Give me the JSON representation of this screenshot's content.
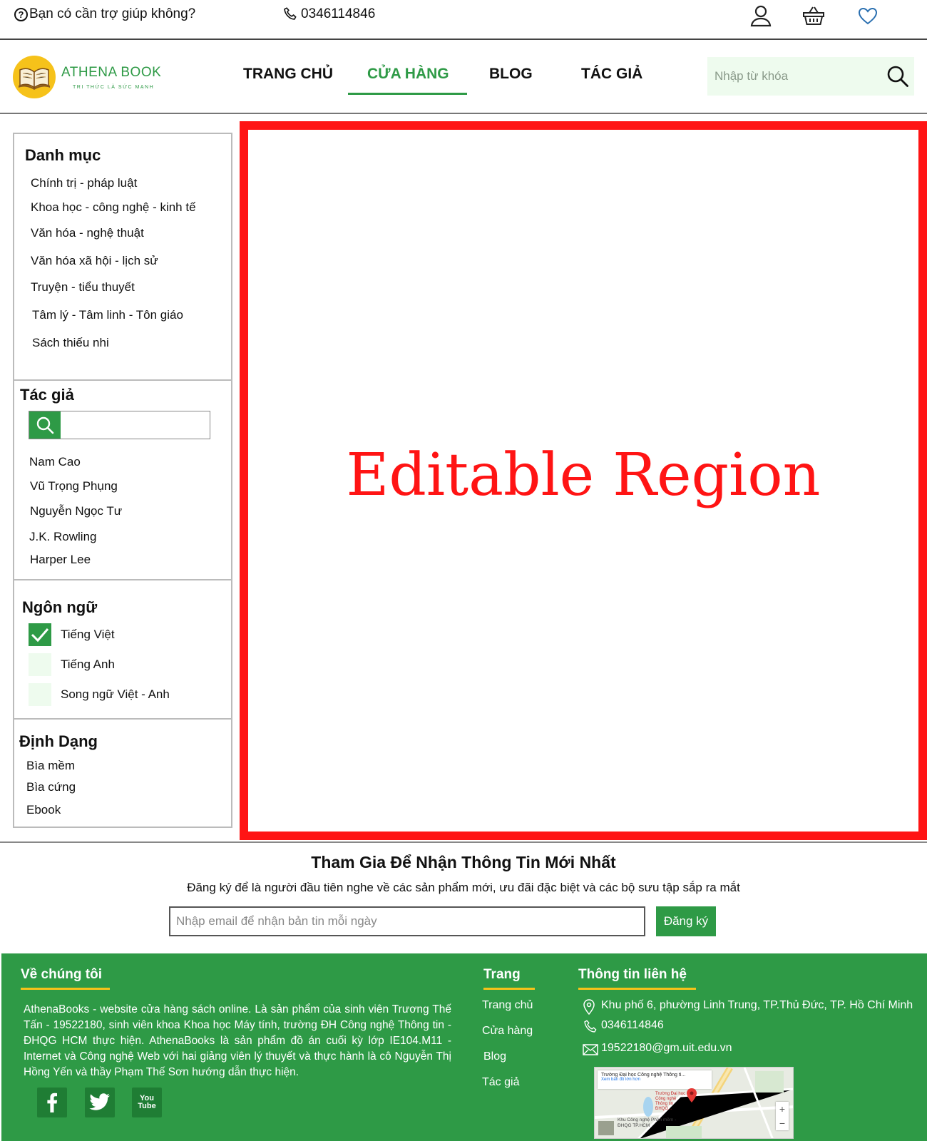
{
  "topbar": {
    "help_text": "Bạn có cần trợ giúp không?",
    "help_icon": "?",
    "phone": "0346114846",
    "icons": [
      "user-icon",
      "basket-icon",
      "heart-icon"
    ]
  },
  "header": {
    "logo_name": "ATHENA BOOK",
    "logo_tagline": "TRI THỨC LÀ SỨC MẠNH",
    "nav": [
      "TRANG CHỦ",
      "CỬA HÀNG",
      "BLOG",
      "TÁC GIẢ"
    ],
    "active_nav": "CỬA HÀNG",
    "search_placeholder": "Nhập từ khóa"
  },
  "sidebar": {
    "categories": {
      "title": "Danh mục",
      "items": [
        "Chính trị - pháp luật",
        "Khoa học - công nghệ - kinh tế",
        "Văn hóa - nghệ thuật",
        "Văn hóa  xã hội - lịch sử",
        "Truyện - tiểu thuyết",
        "Tâm lý - Tâm linh - Tôn giáo",
        "Sách thiếu nhi"
      ]
    },
    "authors": {
      "title": "Tác giả",
      "search_value": "",
      "items": [
        "Nam Cao",
        "Vũ Trọng Phụng",
        "Nguyễn Ngọc Tư",
        "J.K. Rowling",
        "Harper Lee"
      ]
    },
    "languages": {
      "title": "Ngôn ngữ",
      "items": [
        {
          "label": "Tiếng Việt",
          "checked": true
        },
        {
          "label": "Tiếng Anh",
          "checked": false
        },
        {
          "label": "Song ngữ Việt - Anh",
          "checked": false
        }
      ]
    },
    "formats": {
      "title": "Định Dạng",
      "items": [
        "Bìa mềm",
        "Bìa cứng",
        "Ebook"
      ]
    }
  },
  "editable_region": {
    "label": "Editable Region",
    "color": "#ff1414"
  },
  "newsletter": {
    "title": "Tham Gia Để Nhận Thông Tin Mới Nhất",
    "subtitle": "Đăng ký để là người đầu tiên nghe về các sản phẩm mới, ưu đãi đặc biệt và các bộ sưu tập sắp ra mắt",
    "placeholder": "Nhập email để nhận bản tin mỗi ngày",
    "button": "Đăng ký"
  },
  "footer": {
    "about_title": "Về chúng tôi",
    "about_text": "AthenaBooks - website cửa hàng sách online. Là sản phẩm của sinh viên Trương Thế Tấn - 19522180, sinh viên khoa Khoa học Máy tính, trường ĐH Công nghệ Thông tin - ĐHQG HCM thực hiện. AthenaBooks là sản phẩm đồ án cuối kỳ lớp IE104.M11 - Internet và Công nghệ Web với hai giảng viên lý thuyết và thực hành là cô Nguyễn Thị Hồng Yến và thầy Phạm Thế Sơn hướng dẫn thực hiện.",
    "social": [
      "facebook-icon",
      "twitter-icon",
      "youtube-icon"
    ],
    "youtube_text": "You Tube",
    "pages_title": "Trang",
    "pages": [
      "Trang chủ",
      "Cửa hàng",
      "Blog",
      "Tác giả"
    ],
    "contact_title": "Thông tin liên hệ",
    "address": "Khu phố 6, phường Linh Trung, TP.Thủ Đức, TP. Hồ Chí Minh",
    "phone": "0346114846",
    "email": "19522180@gm.uit.edu.vn",
    "map_title": "Trường Đại học Công nghệ Thông ti...",
    "map_link": "Xem bản đồ lớn hơn",
    "map_pin_label": "Trường Đại học Công nghệ Thông tin ĐHQG...",
    "map_place": "Khu Công nghệ Phần mềm - ĐHQG TP.HCM",
    "brand_yellow": "#f6c21a",
    "brand_green": "#2e9a46"
  }
}
